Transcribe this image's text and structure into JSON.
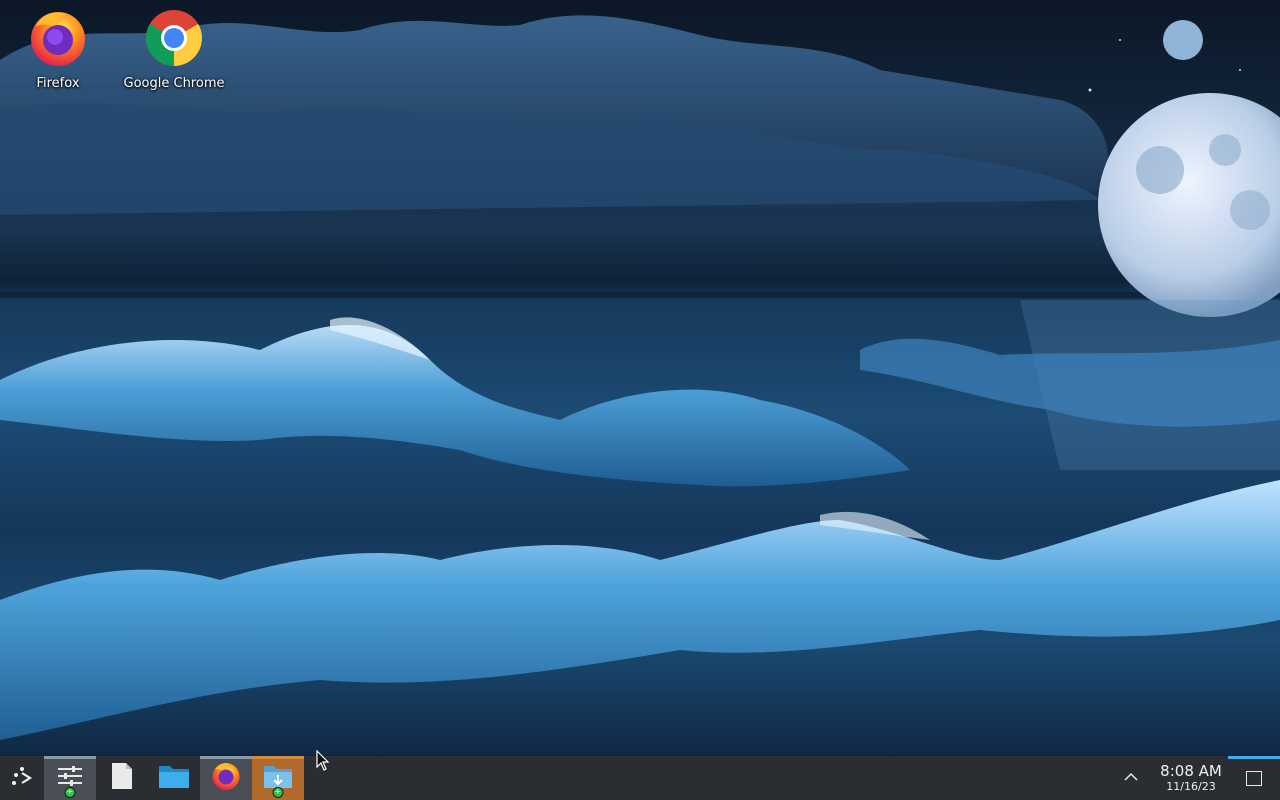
{
  "desktop": {
    "icons": [
      {
        "label": "Firefox",
        "icon": "firefox-icon"
      },
      {
        "label": "Google Chrome",
        "icon": "chrome-icon"
      }
    ]
  },
  "taskbar": {
    "items": [
      {
        "name": "application-launcher",
        "icon": "launcher-icon"
      },
      {
        "name": "system-settings",
        "icon": "settings-sliders-icon",
        "active": true
      },
      {
        "name": "text-editor",
        "icon": "document-icon"
      },
      {
        "name": "file-manager",
        "icon": "folder-icon"
      },
      {
        "name": "firefox",
        "icon": "firefox-icon",
        "active": true
      },
      {
        "name": "downloads-folder",
        "icon": "download-folder-icon",
        "highlight": "#b06a2b"
      }
    ]
  },
  "tray": {
    "expand_symbol": "^",
    "time": "8:08 AM",
    "date": "11/16/23"
  },
  "colors": {
    "taskbar_bg": "#2a2e32",
    "accent": "#3daee9"
  }
}
